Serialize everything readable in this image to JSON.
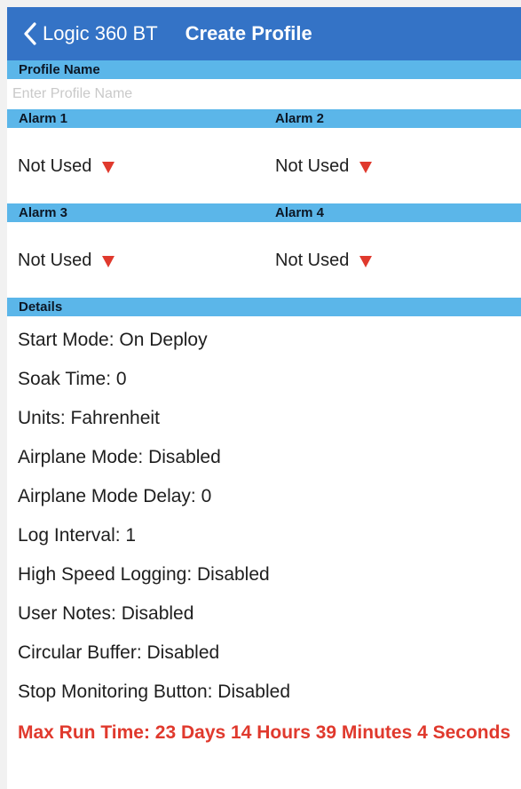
{
  "nav": {
    "back_label": "Logic 360 BT",
    "title": "Create Profile"
  },
  "profile": {
    "section_label": "Profile Name",
    "placeholder": "Enter Profile Name",
    "value": ""
  },
  "alarms": {
    "alarm1": {
      "label": "Alarm 1",
      "value": "Not Used"
    },
    "alarm2": {
      "label": "Alarm 2",
      "value": "Not Used"
    },
    "alarm3": {
      "label": "Alarm 3",
      "value": "Not Used"
    },
    "alarm4": {
      "label": "Alarm 4",
      "value": "Not Used"
    }
  },
  "details": {
    "section_label": "Details",
    "items": [
      "Start Mode: On Deploy",
      "Soak Time: 0",
      "Units: Fahrenheit",
      "Airplane Mode: Disabled",
      "Airplane Mode Delay: 0",
      "Log Interval: 1",
      "High Speed Logging: Disabled",
      "User Notes: Disabled",
      "Circular Buffer: Disabled",
      "Stop Monitoring Button: Disabled"
    ],
    "max_run_time": "Max Run Time: 23 Days 14 Hours 39 Minutes 4 Seconds"
  },
  "colors": {
    "nav_bar": "#3473c6",
    "section_bar": "#5bb6e9",
    "accent_red": "#e0392d",
    "page_background": "#f1f1f1"
  },
  "icons": {
    "back": "chevron-left-icon",
    "dropdown": "triangle-down-icon"
  }
}
